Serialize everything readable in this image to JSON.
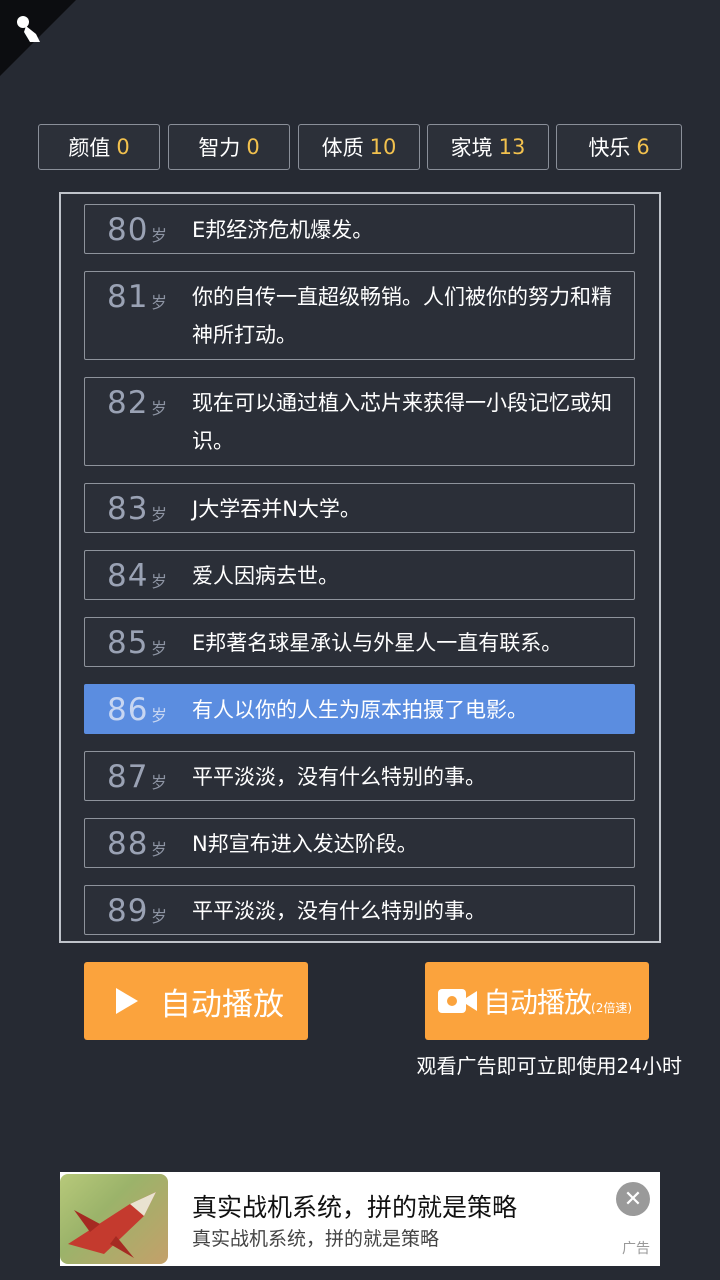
{
  "stats": [
    {
      "label": "颜值",
      "value": "0"
    },
    {
      "label": "智力",
      "value": "0"
    },
    {
      "label": "体质",
      "value": "10"
    },
    {
      "label": "家境",
      "value": "13"
    },
    {
      "label": "快乐",
      "value": "6"
    }
  ],
  "age_unit": "岁",
  "events": [
    {
      "age": "80",
      "text": "E邦经济危机爆发。"
    },
    {
      "age": "81",
      "text": "你的自传一直超级畅销。人们被你的努力和精神所打动。"
    },
    {
      "age": "82",
      "text": "现在可以通过植入芯片来获得一小段记忆或知识。"
    },
    {
      "age": "83",
      "text": "J大学吞并N大学。"
    },
    {
      "age": "84",
      "text": "爱人因病去世。"
    },
    {
      "age": "85",
      "text": "E邦著名球星承认与外星人一直有联系。"
    },
    {
      "age": "86",
      "text": "有人以你的人生为原本拍摄了电影。"
    },
    {
      "age": "87",
      "text": "平平淡淡，没有什么特别的事。"
    },
    {
      "age": "88",
      "text": "N邦宣布进入发达阶段。"
    },
    {
      "age": "89",
      "text": "平平淡淡，没有什么特别的事。"
    }
  ],
  "active_event_index": 6,
  "buttons": {
    "auto_play": "自动播放",
    "auto_play_fast": "自动播放",
    "auto_play_fast_suffix": "(2倍速)",
    "ad_note": "观看广告即可立即使用24小时"
  },
  "ad": {
    "title": "真实战机系统，拼的就是策略",
    "description": "真实战机系统，拼的就是策略",
    "tag": "广告"
  },
  "colors": {
    "background": "#262a33",
    "accent_orange": "#fba33d",
    "highlight_blue": "#5b8de0",
    "stat_value": "#f2c14e"
  }
}
